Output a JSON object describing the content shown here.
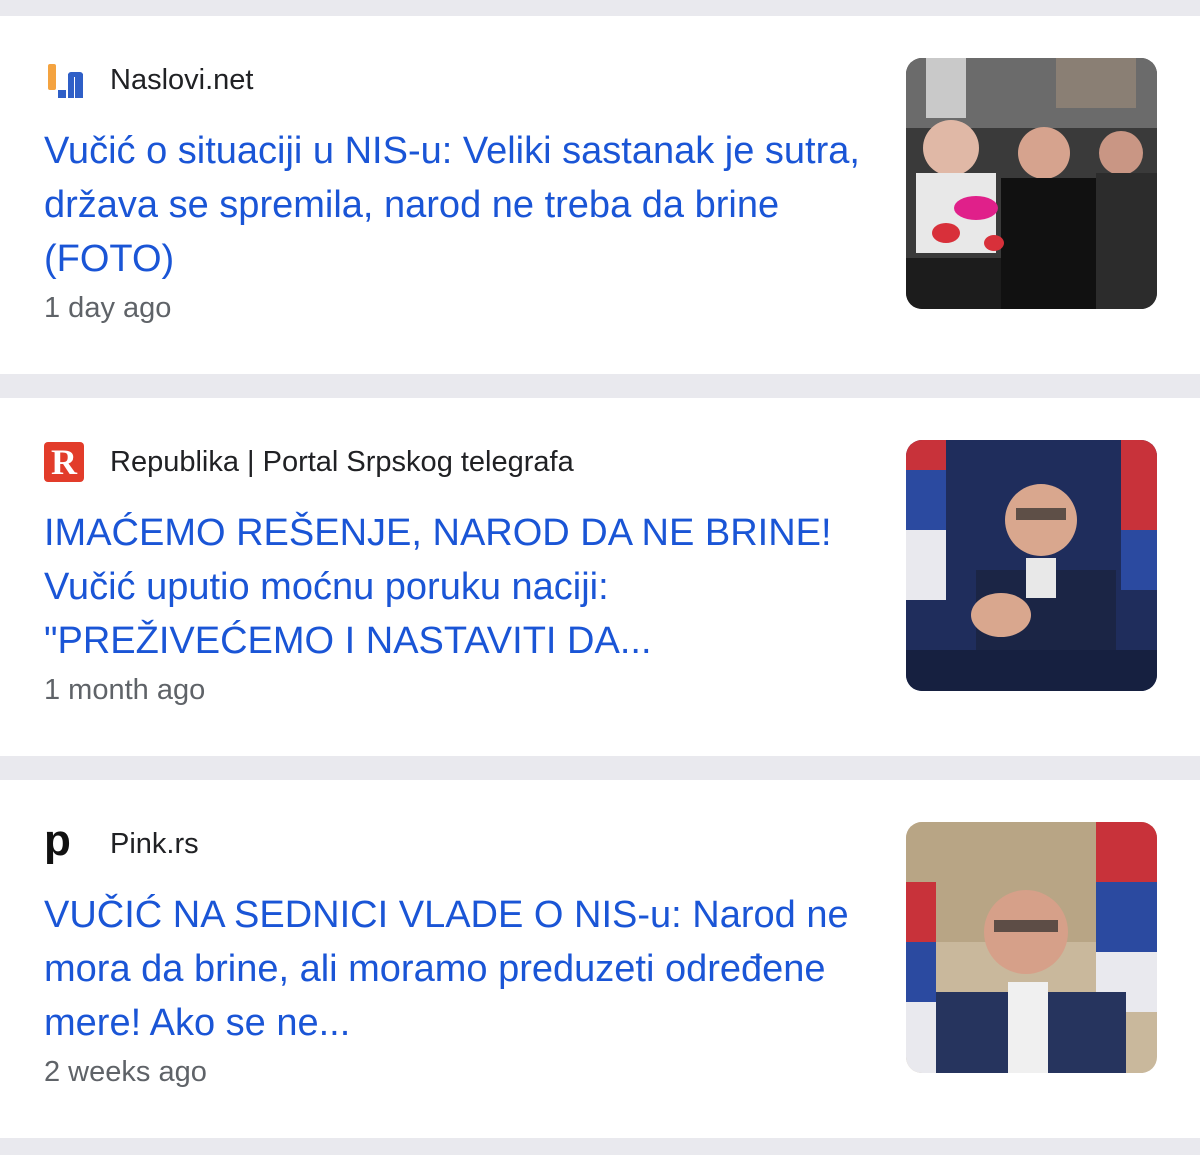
{
  "articles": [
    {
      "source": "Naslovi.net",
      "logo_icon": "naslovi-logo-icon",
      "headline": "Vučić o situaciji u NIS-u: Veliki sastanak je sutra, država se spremila, narod ne treba da brine (FOTO)",
      "age": "1 day ago"
    },
    {
      "source": "Republika | Portal Srpskog telegrafa",
      "logo_icon": "republika-logo-icon",
      "logo_letter": "R",
      "headline": "IMAĆEMO REŠENJE, NAROD DA NE BRINE! Vučić uputio moćnu poruku naciji: \"PREŽIVEĆEMO I NASTAVITI DA...",
      "age": "1 month ago"
    },
    {
      "source": "Pink.rs",
      "logo_icon": "pink-logo-icon",
      "logo_letter": "p",
      "headline": "VUČIĆ NA SEDNICI VLADE O NIS-u: Narod ne mora da brine, ali moramo preduzeti određene mere! Ako se ne...",
      "age": "2 weeks ago"
    }
  ],
  "colors": {
    "headline": "#1a55d6",
    "background": "#e9e9ee",
    "card": "#ffffff"
  }
}
